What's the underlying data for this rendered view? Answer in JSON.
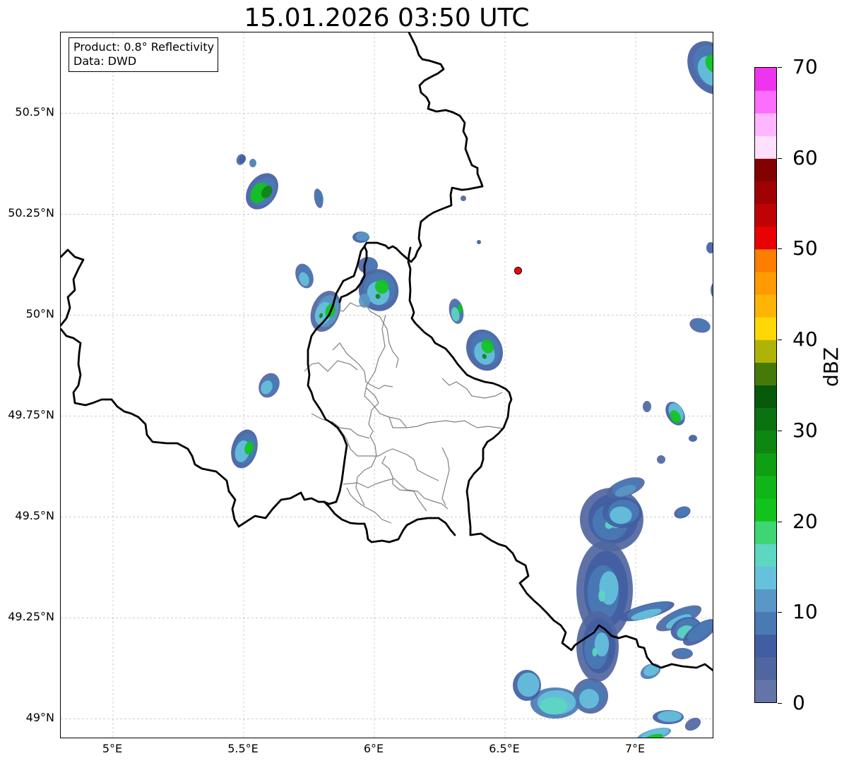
{
  "title": "15.01.2026 03:50 UTC",
  "info_box": {
    "product": "Product: 0.8° Reflectivity",
    "source": "Data: DWD"
  },
  "latitude_labels": [
    "50.5°N",
    "50.25°N",
    "50°N",
    "49.75°N",
    "49.5°N",
    "49.25°N",
    "49°N"
  ],
  "longitude_labels": [
    "5°E",
    "5.5°E",
    "6°E",
    "6.5°E",
    "7°E"
  ],
  "colorbar": {
    "unit": "dBZ",
    "ticks": [
      "0",
      "10",
      "20",
      "30",
      "40",
      "50",
      "60",
      "70"
    ],
    "colors": [
      "#6375a8",
      "#5066a0",
      "#425ea3",
      "#4a7ab4",
      "#5897c6",
      "#65c1dc",
      "#5dd6c2",
      "#3dd672",
      "#10c41c",
      "#10b618",
      "#109e14",
      "#0e8612",
      "#0a7210",
      "#065a0a",
      "#467a08",
      "#aeb406",
      "#fed804",
      "#feb404",
      "#fe9a02",
      "#fe7e02",
      "#e80202",
      "#c00204",
      "#a00204",
      "#820202",
      "#fee0fe",
      "#feb6fe",
      "#fe6efe",
      "#ee34ee"
    ]
  },
  "marker": {
    "lon": 6.55,
    "lat": 50.11,
    "color": "#ff0000"
  }
}
